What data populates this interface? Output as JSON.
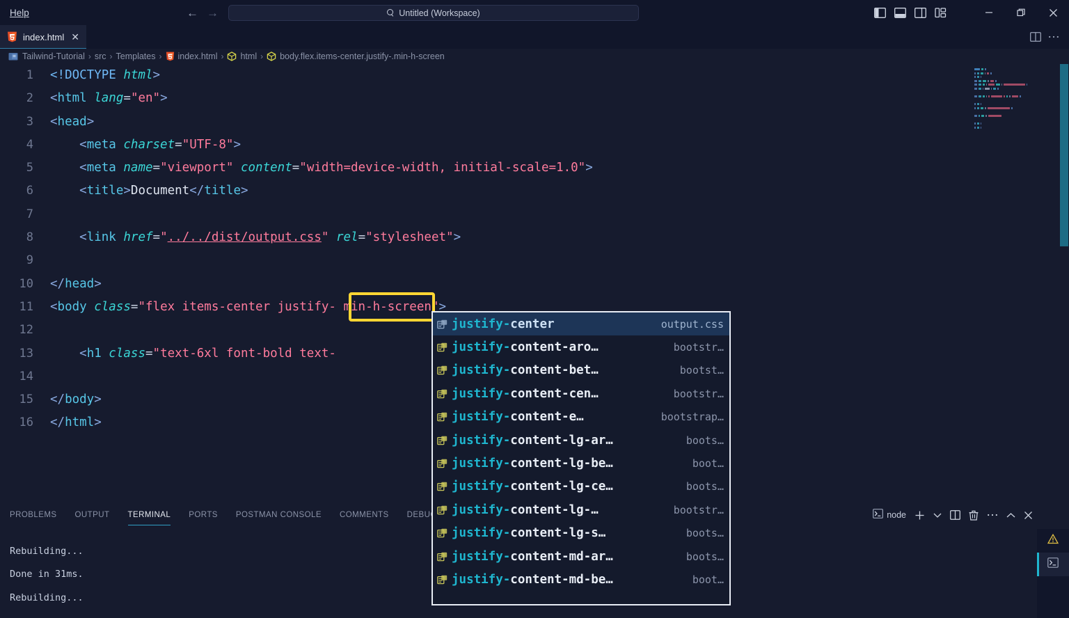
{
  "titlebar": {
    "menus": [
      {
        "label": "Help",
        "accel": "H"
      }
    ],
    "nav": {
      "back_icon": "arrow-left-icon",
      "forward_icon": "arrow-right-icon"
    },
    "command_center": {
      "text": "Untitled (Workspace)",
      "icon": "search-icon"
    },
    "layout_buttons": [
      {
        "name": "toggle-primary-sidebar",
        "icon": "layout-sidebar-left-icon"
      },
      {
        "name": "toggle-panel",
        "icon": "layout-panel-icon"
      },
      {
        "name": "toggle-secondary-sidebar",
        "icon": "layout-sidebar-right-icon"
      },
      {
        "name": "customize-layout",
        "icon": "layout-grid-icon"
      }
    ],
    "window_controls": [
      {
        "name": "minimize-button",
        "icon": "minimize-icon"
      },
      {
        "name": "maximize-button",
        "icon": "restore-icon"
      },
      {
        "name": "close-button",
        "icon": "close-icon"
      }
    ]
  },
  "tabbar": {
    "tabs": [
      {
        "label": "index.html",
        "icon": "html5-icon",
        "close_icon": "close-icon",
        "active": true
      }
    ],
    "actions": [
      {
        "name": "split-editor-button",
        "icon": "split-editor-icon"
      },
      {
        "name": "editor-more-actions-button",
        "icon": "ellipsis-icon"
      }
    ]
  },
  "breadcrumb": {
    "items": [
      {
        "label": "Tailwind-Tutorial",
        "icon": "folder-icon"
      },
      {
        "label": "src",
        "icon": ""
      },
      {
        "label": "Templates",
        "icon": ""
      },
      {
        "label": "index.html",
        "icon": "html5-icon"
      },
      {
        "label": "html",
        "icon": "symbol-field-icon"
      },
      {
        "label": "body.flex.items-center.justify-.min-h-screen",
        "icon": "symbol-field-icon"
      }
    ],
    "separator": "›"
  },
  "editor": {
    "lines": [
      {
        "n": "1",
        "tokens": [
          {
            "t": "<!DOCTYPE ",
            "c": "t-doctype"
          },
          {
            "t": "html",
            "c": "t-attr"
          },
          {
            "t": ">",
            "c": "t-punct"
          }
        ]
      },
      {
        "n": "2",
        "tokens": [
          {
            "t": "<",
            "c": "t-punct"
          },
          {
            "t": "html ",
            "c": "t-tagname"
          },
          {
            "t": "lang",
            "c": "t-attr"
          },
          {
            "t": "=",
            "c": "t-eq"
          },
          {
            "t": "\"en\"",
            "c": "t-str"
          },
          {
            "t": ">",
            "c": "t-punct"
          }
        ]
      },
      {
        "n": "3",
        "tokens": [
          {
            "t": "<",
            "c": "t-punct"
          },
          {
            "t": "head",
            "c": "t-tagname"
          },
          {
            "t": ">",
            "c": "t-punct"
          }
        ]
      },
      {
        "n": "4",
        "tokens": [
          {
            "t": "    <",
            "c": "t-punct"
          },
          {
            "t": "meta ",
            "c": "t-tagname"
          },
          {
            "t": "charset",
            "c": "t-attr"
          },
          {
            "t": "=",
            "c": "t-eq"
          },
          {
            "t": "\"UTF-8\"",
            "c": "t-str"
          },
          {
            "t": ">",
            "c": "t-punct"
          }
        ]
      },
      {
        "n": "5",
        "tokens": [
          {
            "t": "    <",
            "c": "t-punct"
          },
          {
            "t": "meta ",
            "c": "t-tagname"
          },
          {
            "t": "name",
            "c": "t-attr"
          },
          {
            "t": "=",
            "c": "t-eq"
          },
          {
            "t": "\"viewport\" ",
            "c": "t-str"
          },
          {
            "t": "content",
            "c": "t-attr"
          },
          {
            "t": "=",
            "c": "t-eq"
          },
          {
            "t": "\"width=device-width, initial-scale=1.0\"",
            "c": "t-str"
          },
          {
            "t": ">",
            "c": "t-punct"
          }
        ]
      },
      {
        "n": "6",
        "tokens": [
          {
            "t": "    <",
            "c": "t-punct"
          },
          {
            "t": "title",
            "c": "t-tagname"
          },
          {
            "t": ">",
            "c": "t-punct"
          },
          {
            "t": "Document",
            "c": "t-text"
          },
          {
            "t": "</",
            "c": "t-punct"
          },
          {
            "t": "title",
            "c": "t-tagname"
          },
          {
            "t": ">",
            "c": "t-punct"
          }
        ]
      },
      {
        "n": "7",
        "tokens": []
      },
      {
        "n": "8",
        "tokens": [
          {
            "t": "    <",
            "c": "t-punct"
          },
          {
            "t": "link ",
            "c": "t-tagname"
          },
          {
            "t": "href",
            "c": "t-attr"
          },
          {
            "t": "=",
            "c": "t-eq"
          },
          {
            "t": "\"",
            "c": "t-str"
          },
          {
            "t": "../../dist/output.css",
            "c": "t-link"
          },
          {
            "t": "\" ",
            "c": "t-str"
          },
          {
            "t": "rel",
            "c": "t-attr"
          },
          {
            "t": "=",
            "c": "t-eq"
          },
          {
            "t": "\"stylesheet\"",
            "c": "t-str"
          },
          {
            "t": ">",
            "c": "t-punct"
          }
        ]
      },
      {
        "n": "9",
        "tokens": []
      },
      {
        "n": "10",
        "tokens": [
          {
            "t": "</",
            "c": "t-punct"
          },
          {
            "t": "head",
            "c": "t-tagname"
          },
          {
            "t": ">",
            "c": "t-punct"
          }
        ]
      },
      {
        "n": "11",
        "tokens": [
          {
            "t": "<",
            "c": "t-punct"
          },
          {
            "t": "body ",
            "c": "t-tagname"
          },
          {
            "t": "class",
            "c": "t-attr"
          },
          {
            "t": "=",
            "c": "t-eq"
          },
          {
            "t": "\"flex items-center justify- min-h-screen\"",
            "c": "t-str"
          },
          {
            "t": ">",
            "c": "t-punct"
          }
        ]
      },
      {
        "n": "12",
        "tokens": []
      },
      {
        "n": "13",
        "tokens": [
          {
            "t": "    <",
            "c": "t-punct"
          },
          {
            "t": "h1 ",
            "c": "t-tagname"
          },
          {
            "t": "class",
            "c": "t-attr"
          },
          {
            "t": "=",
            "c": "t-eq"
          },
          {
            "t": "\"text-6xl font-bold text-",
            "c": "t-str"
          }
        ]
      },
      {
        "n": "14",
        "tokens": []
      },
      {
        "n": "15",
        "tokens": [
          {
            "t": "</",
            "c": "t-punct"
          },
          {
            "t": "body",
            "c": "t-tagname"
          },
          {
            "t": ">",
            "c": "t-punct"
          }
        ]
      },
      {
        "n": "16",
        "tokens": [
          {
            "t": "</",
            "c": "t-punct"
          },
          {
            "t": "html",
            "c": "t-tagname"
          },
          {
            "t": ">",
            "c": "t-punct"
          }
        ]
      }
    ],
    "annotation": {
      "name": "justify-highlight-box",
      "color": "#ffd633",
      "target_text": "justify-"
    }
  },
  "suggest": {
    "items": [
      {
        "match": "justify-",
        "rest": "center",
        "detail": "output.css",
        "selected": true
      },
      {
        "match": "justify-",
        "rest": "content-aro…",
        "detail": "bootstr…",
        "selected": false
      },
      {
        "match": "justify-",
        "rest": "content-bet…",
        "detail": "bootst…",
        "selected": false
      },
      {
        "match": "justify-",
        "rest": "content-cen…",
        "detail": "bootstr…",
        "selected": false
      },
      {
        "match": "justify-",
        "rest": "content-e…",
        "detail": "bootstrap…",
        "selected": false
      },
      {
        "match": "justify-",
        "rest": "content-lg-ar…",
        "detail": "boots…",
        "selected": false
      },
      {
        "match": "justify-",
        "rest": "content-lg-be…",
        "detail": "boot…",
        "selected": false
      },
      {
        "match": "justify-",
        "rest": "content-lg-ce…",
        "detail": "boots…",
        "selected": false
      },
      {
        "match": "justify-",
        "rest": "content-lg-…",
        "detail": "bootstr…",
        "selected": false
      },
      {
        "match": "justify-",
        "rest": "content-lg-s…",
        "detail": "boots…",
        "selected": false
      },
      {
        "match": "justify-",
        "rest": "content-md-ar…",
        "detail": "boots…",
        "selected": false
      },
      {
        "match": "justify-",
        "rest": "content-md-be…",
        "detail": "boot…",
        "selected": false
      }
    ],
    "item_icon": "css-property-icon"
  },
  "panel": {
    "tabs": [
      {
        "label": "PROBLEMS",
        "active": false
      },
      {
        "label": "OUTPUT",
        "active": false
      },
      {
        "label": "TERMINAL",
        "active": true
      },
      {
        "label": "PORTS",
        "active": false
      },
      {
        "label": "POSTMAN CONSOLE",
        "active": false
      },
      {
        "label": "COMMENTS",
        "active": false
      },
      {
        "label": "DEBUG CONSOLE",
        "active": false
      }
    ],
    "actions": [
      {
        "name": "active-terminal-label",
        "label": "node",
        "icon": "terminal-icon"
      },
      {
        "name": "new-terminal-button",
        "label": "",
        "icon": "plus-icon"
      },
      {
        "name": "terminal-profile-dropdown",
        "label": "",
        "icon": "chevron-down-icon"
      },
      {
        "name": "split-terminal-button",
        "label": "",
        "icon": "split-icon"
      },
      {
        "name": "kill-terminal-button",
        "label": "",
        "icon": "trash-icon"
      },
      {
        "name": "panel-more-actions-button",
        "label": "",
        "icon": "ellipsis-icon"
      },
      {
        "name": "maximize-panel-button",
        "label": "",
        "icon": "chevron-up-icon"
      },
      {
        "name": "close-panel-button",
        "label": "",
        "icon": "close-icon"
      }
    ],
    "terminal_output": [
      "Rebuilding...",
      "Done in 31ms.",
      "Rebuilding..."
    ],
    "terminal_sidebar": [
      {
        "name": "terminal-warning-item",
        "icon": "warning-icon",
        "active": false
      },
      {
        "name": "terminal-instance-item",
        "icon": "terminal-icon",
        "active": true
      }
    ]
  },
  "colors": {
    "editor_bg": "#161b2e",
    "chrome_bg": "#11162a",
    "accent": "#1fb6cf",
    "highlight": "#ffd633",
    "string": "#ff7b9c",
    "tag": "#57c7e8",
    "attribute": "#3bd6d6"
  }
}
